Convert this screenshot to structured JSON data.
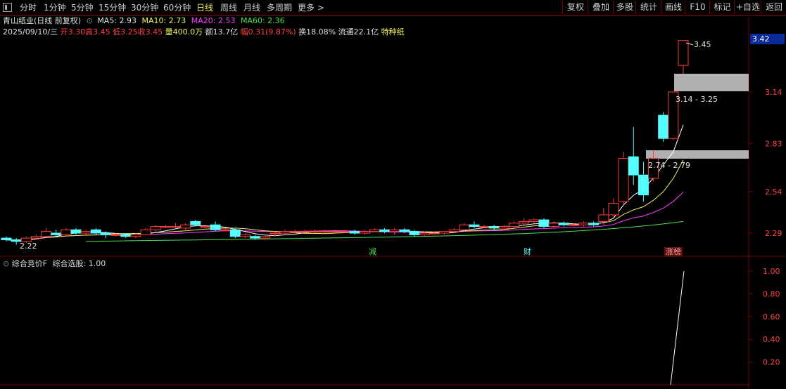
{
  "toolbar": {
    "left_items": [
      "分时",
      "1分钟",
      "5分钟",
      "15分钟",
      "30分钟",
      "60分钟",
      "日线",
      "周线",
      "月线",
      "多周期",
      "更多"
    ],
    "active_item": "日线",
    "right_items": [
      "复权",
      "叠加",
      "多股",
      "统计",
      "画线",
      "F10",
      "标记",
      "+自选",
      "返回"
    ]
  },
  "stock": {
    "name_line": "青山纸业(日线 前复权)",
    "ma5": "MA5: 2.93",
    "ma10": "MA10: 2.73",
    "ma20": "MA20: 2.53",
    "ma60": "MA60: 2.36",
    "date": "2025/09/10/三",
    "open": "开3.30",
    "high": "高3.45",
    "low": "低3.25",
    "close": "收3.45",
    "volume": "量400.0万",
    "amount": "额13.7亿",
    "change": "幅0.31(9.87%)",
    "turnover": "换18.08%",
    "float_cap": "流通22.1亿",
    "sector": "特种纸"
  },
  "current_price_label": "3.42",
  "annotations": {
    "high_label": "3.45",
    "low_label": "2.22",
    "zone1": "3.14 - 3.25",
    "zone2": "2.74 - 2.79",
    "marker1": "减",
    "marker2": "财",
    "marker3": "涨榜"
  },
  "indicator": {
    "title": "综合竞价F",
    "value_text": "综合选股: 1.00"
  },
  "colors": {
    "up": "#ff3c3c",
    "down": "#54ffff",
    "ma5": "#ffffff",
    "ma10": "#f2f25a",
    "ma20": "#ff3cff",
    "ma60": "#4ee04e",
    "border": "#7a0000"
  },
  "chart_data": {
    "type": "candlestick",
    "y_axis_ticks": [
      2.29,
      2.54,
      2.83,
      3.14
    ],
    "indicator_axis_ticks": [
      0.2,
      0.4,
      0.6,
      0.8,
      1.0
    ],
    "candles": [
      {
        "o": 2.26,
        "h": 2.27,
        "l": 2.24,
        "c": 2.25
      },
      {
        "o": 2.25,
        "h": 2.26,
        "l": 2.22,
        "c": 2.24
      },
      {
        "o": 2.24,
        "h": 2.27,
        "l": 2.23,
        "c": 2.26
      },
      {
        "o": 2.26,
        "h": 2.28,
        "l": 2.25,
        "c": 2.27
      },
      {
        "o": 2.27,
        "h": 2.32,
        "l": 2.26,
        "c": 2.3
      },
      {
        "o": 2.29,
        "h": 2.31,
        "l": 2.27,
        "c": 2.28
      },
      {
        "o": 2.28,
        "h": 2.32,
        "l": 2.27,
        "c": 2.31
      },
      {
        "o": 2.31,
        "h": 2.32,
        "l": 2.28,
        "c": 2.29
      },
      {
        "o": 2.29,
        "h": 2.31,
        "l": 2.28,
        "c": 2.3
      },
      {
        "o": 2.31,
        "h": 2.32,
        "l": 2.28,
        "c": 2.29
      },
      {
        "o": 2.29,
        "h": 2.3,
        "l": 2.26,
        "c": 2.28
      },
      {
        "o": 2.28,
        "h": 2.29,
        "l": 2.27,
        "c": 2.28
      },
      {
        "o": 2.28,
        "h": 2.29,
        "l": 2.26,
        "c": 2.27
      },
      {
        "o": 2.27,
        "h": 2.29,
        "l": 2.26,
        "c": 2.28
      },
      {
        "o": 2.28,
        "h": 2.32,
        "l": 2.28,
        "c": 2.31
      },
      {
        "o": 2.31,
        "h": 2.34,
        "l": 2.3,
        "c": 2.33
      },
      {
        "o": 2.33,
        "h": 2.34,
        "l": 2.32,
        "c": 2.33
      },
      {
        "o": 2.33,
        "h": 2.35,
        "l": 2.32,
        "c": 2.33
      },
      {
        "o": 2.32,
        "h": 2.35,
        "l": 2.31,
        "c": 2.34
      },
      {
        "o": 2.36,
        "h": 2.37,
        "l": 2.33,
        "c": 2.34
      },
      {
        "o": 2.33,
        "h": 2.34,
        "l": 2.32,
        "c": 2.33
      },
      {
        "o": 2.34,
        "h": 2.36,
        "l": 2.3,
        "c": 2.31
      },
      {
        "o": 2.31,
        "h": 2.32,
        "l": 2.3,
        "c": 2.31
      },
      {
        "o": 2.31,
        "h": 2.32,
        "l": 2.26,
        "c": 2.27
      },
      {
        "o": 2.27,
        "h": 2.29,
        "l": 2.26,
        "c": 2.28
      },
      {
        "o": 2.27,
        "h": 2.28,
        "l": 2.25,
        "c": 2.26
      },
      {
        "o": 2.26,
        "h": 2.28,
        "l": 2.25,
        "c": 2.27
      },
      {
        "o": 2.29,
        "h": 2.3,
        "l": 2.27,
        "c": 2.29
      },
      {
        "o": 2.29,
        "h": 2.31,
        "l": 2.28,
        "c": 2.3
      },
      {
        "o": 2.3,
        "h": 2.31,
        "l": 2.29,
        "c": 2.3
      },
      {
        "o": 2.3,
        "h": 2.31,
        "l": 2.29,
        "c": 2.3
      },
      {
        "o": 2.3,
        "h": 2.31,
        "l": 2.29,
        "c": 2.3
      },
      {
        "o": 2.3,
        "h": 2.31,
        "l": 2.29,
        "c": 2.3
      },
      {
        "o": 2.3,
        "h": 2.31,
        "l": 2.29,
        "c": 2.3
      },
      {
        "o": 2.3,
        "h": 2.31,
        "l": 2.29,
        "c": 2.3
      },
      {
        "o": 2.3,
        "h": 2.31,
        "l": 2.28,
        "c": 2.29
      },
      {
        "o": 2.29,
        "h": 2.31,
        "l": 2.28,
        "c": 2.3
      },
      {
        "o": 2.3,
        "h": 2.32,
        "l": 2.3,
        "c": 2.31
      },
      {
        "o": 2.31,
        "h": 2.32,
        "l": 2.29,
        "c": 2.3
      },
      {
        "o": 2.3,
        "h": 2.32,
        "l": 2.28,
        "c": 2.31
      },
      {
        "o": 2.31,
        "h": 2.32,
        "l": 2.29,
        "c": 2.3
      },
      {
        "o": 2.3,
        "h": 2.31,
        "l": 2.27,
        "c": 2.28
      },
      {
        "o": 2.28,
        "h": 2.3,
        "l": 2.27,
        "c": 2.29
      },
      {
        "o": 2.29,
        "h": 2.3,
        "l": 2.28,
        "c": 2.29
      },
      {
        "o": 2.29,
        "h": 2.3,
        "l": 2.28,
        "c": 2.3
      },
      {
        "o": 2.3,
        "h": 2.32,
        "l": 2.29,
        "c": 2.31
      },
      {
        "o": 2.31,
        "h": 2.35,
        "l": 2.3,
        "c": 2.34
      },
      {
        "o": 2.34,
        "h": 2.36,
        "l": 2.32,
        "c": 2.33
      },
      {
        "o": 2.33,
        "h": 2.34,
        "l": 2.32,
        "c": 2.33
      },
      {
        "o": 2.33,
        "h": 2.34,
        "l": 2.31,
        "c": 2.32
      },
      {
        "o": 2.32,
        "h": 2.34,
        "l": 2.31,
        "c": 2.33
      },
      {
        "o": 2.33,
        "h": 2.36,
        "l": 2.32,
        "c": 2.35
      },
      {
        "o": 2.35,
        "h": 2.38,
        "l": 2.34,
        "c": 2.36
      },
      {
        "o": 2.36,
        "h": 2.38,
        "l": 2.35,
        "c": 2.37
      },
      {
        "o": 2.37,
        "h": 2.38,
        "l": 2.32,
        "c": 2.33
      },
      {
        "o": 2.33,
        "h": 2.36,
        "l": 2.32,
        "c": 2.35
      },
      {
        "o": 2.35,
        "h": 2.36,
        "l": 2.33,
        "c": 2.34
      },
      {
        "o": 2.34,
        "h": 2.35,
        "l": 2.33,
        "c": 2.34
      },
      {
        "o": 2.34,
        "h": 2.36,
        "l": 2.33,
        "c": 2.35
      },
      {
        "o": 2.35,
        "h": 2.36,
        "l": 2.33,
        "c": 2.34
      },
      {
        "o": 2.36,
        "h": 2.44,
        "l": 2.34,
        "c": 2.4
      },
      {
        "o": 2.4,
        "h": 2.5,
        "l": 2.38,
        "c": 2.47
      },
      {
        "o": 2.48,
        "h": 2.78,
        "l": 2.46,
        "c": 2.74
      },
      {
        "o": 2.75,
        "h": 2.93,
        "l": 2.58,
        "c": 2.64
      },
      {
        "o": 2.64,
        "h": 2.72,
        "l": 2.48,
        "c": 2.52
      },
      {
        "o": 2.62,
        "h": 2.79,
        "l": 2.6,
        "c": 2.74
      },
      {
        "o": 3.0,
        "h": 3.02,
        "l": 2.84,
        "c": 2.86
      },
      {
        "o": 2.86,
        "h": 3.14,
        "l": 2.85,
        "c": 3.14
      },
      {
        "o": 3.3,
        "h": 3.45,
        "l": 3.25,
        "c": 3.45
      }
    ]
  }
}
